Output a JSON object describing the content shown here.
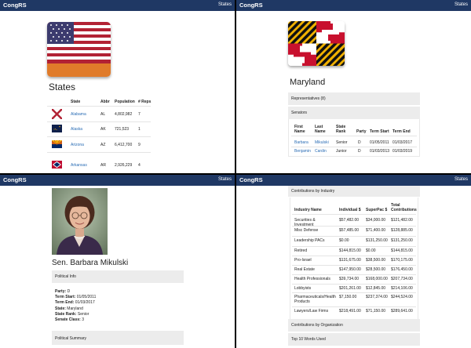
{
  "navbar": {
    "brand": "CongRS",
    "nav_link": "States"
  },
  "states_page": {
    "title": "States",
    "table": {
      "headers": [
        "State",
        "Abbr",
        "Population",
        "# Reps"
      ],
      "rows": [
        {
          "name": "Alabama",
          "abbr": "AL",
          "population": "4,802,982",
          "reps": "7"
        },
        {
          "name": "Alaska",
          "abbr": "AK",
          "population": "721,523",
          "reps": "1"
        },
        {
          "name": "Arizona",
          "abbr": "AZ",
          "population": "6,412,700",
          "reps": "9"
        },
        {
          "name": "Arkansas",
          "abbr": "AR",
          "population": "2,926,229",
          "reps": "4"
        }
      ]
    }
  },
  "state_detail": {
    "title": "Maryland",
    "representatives_label": "Representatives (8)",
    "senators_label": "Senators",
    "senators_table": {
      "headers": [
        "First Name",
        "Last Name",
        "State Rank",
        "Party",
        "Term Start",
        "Term End"
      ],
      "rows": [
        {
          "first": "Barbara",
          "last": "Mikulski",
          "rank": "Senior",
          "party": "D",
          "start": "01/05/2011",
          "end": "01/03/2017"
        },
        {
          "first": "Benjamin",
          "last": "Cardin",
          "rank": "Junior",
          "party": "D",
          "start": "01/03/2013",
          "end": "01/03/2019"
        }
      ]
    }
  },
  "senator_page": {
    "name": "Sen. Barbara Mikulski",
    "political_info_label": "Political Info",
    "info": [
      {
        "label": "Party:",
        "value": "D"
      },
      {
        "label": "Term Start:",
        "value": "01/05/2011"
      },
      {
        "label": "Term End:",
        "value": "01/03/2017"
      },
      {
        "label": "State:",
        "value": "Maryland"
      },
      {
        "label": "State Rank:",
        "value": "Senior"
      },
      {
        "label": "Senate Class:",
        "value": "3"
      }
    ],
    "political_summary_label": "Political Summary"
  },
  "contributions_page": {
    "industry_label": "Contributions by Industry",
    "headers": [
      "Industry Name",
      "Individual $",
      "SuperPac $",
      "Total Contributions"
    ],
    "rows": [
      {
        "industry": "Securities & Investment",
        "individual": "$57,482.00",
        "superpac": "$34,000.00",
        "total": "$121,482.00"
      },
      {
        "industry": "Misc Defense",
        "individual": "$57,485.00",
        "superpac": "$71,400.00",
        "total": "$128,885.00"
      },
      {
        "industry": "Leadership PACs",
        "individual": "$0.00",
        "superpac": "$131,250.00",
        "total": "$131,250.00"
      },
      {
        "industry": "Retired",
        "individual": "$144,815.00",
        "superpac": "$0.00",
        "total": "$144,815.00"
      },
      {
        "industry": "Pro-Israel",
        "individual": "$131,675.00",
        "superpac": "$38,500.00",
        "total": "$170,175.00"
      },
      {
        "industry": "Real Estate",
        "individual": "$147,950.00",
        "superpac": "$28,500.00",
        "total": "$176,450.00"
      },
      {
        "industry": "Health Professionals",
        "individual": "$39,734.00",
        "superpac": "$168,000.00",
        "total": "$207,734.00"
      },
      {
        "industry": "Lobbyists",
        "individual": "$201,261.00",
        "superpac": "$12,845.00",
        "total": "$214,106.00"
      },
      {
        "industry": "Pharmaceuticals/Health Products",
        "individual": "$7,150.00",
        "superpac": "$237,374.00",
        "total": "$244,524.00"
      },
      {
        "industry": "Lawyers/Law Firms",
        "individual": "$218,491.00",
        "superpac": "$71,150.00",
        "total": "$289,641.00"
      }
    ],
    "organization_label": "Contributions by Organization",
    "top_words_label": "Top 10 Words Used"
  },
  "colors": {
    "navbar": "#1f3864",
    "link": "#2a6db5",
    "section_bar": "#ececec"
  }
}
